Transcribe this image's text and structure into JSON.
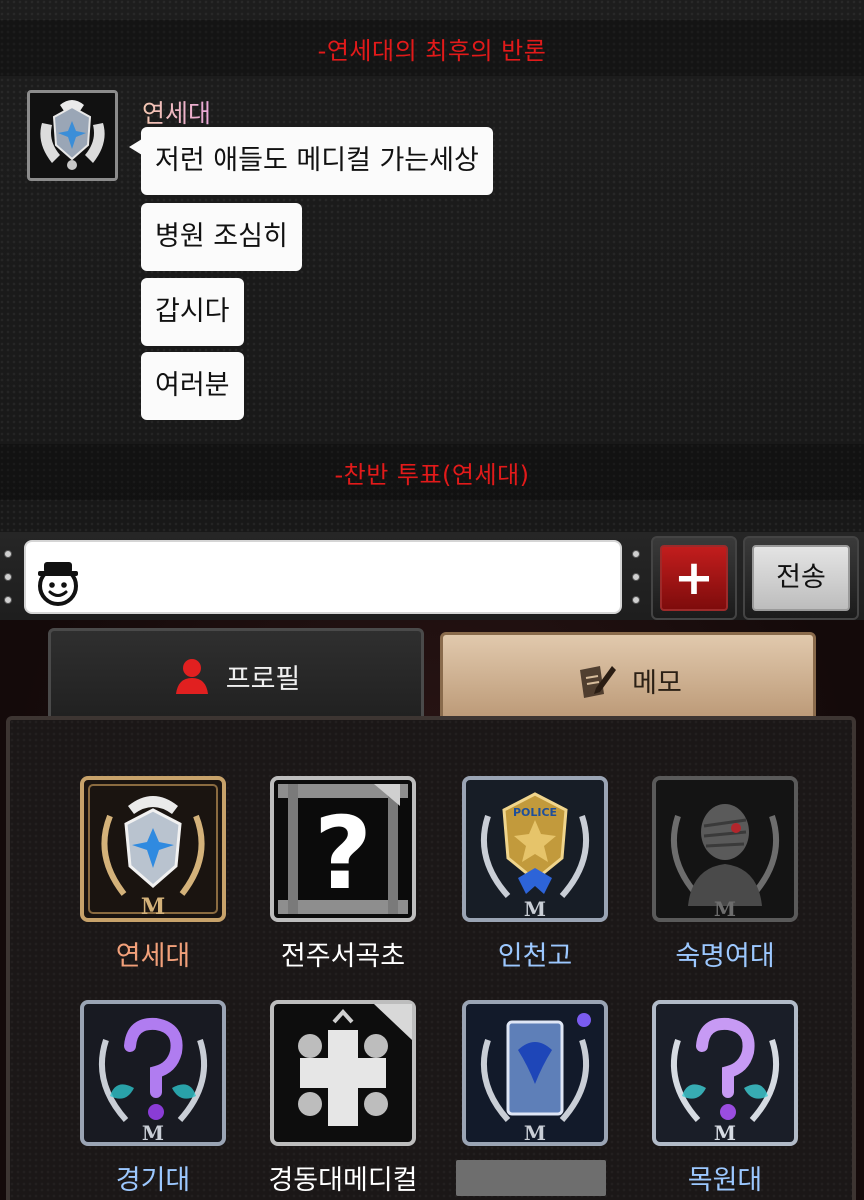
{
  "chat": {
    "system_top": "-연세대의 최후의 반론",
    "system_bottom": "-찬반 투표(연세대)",
    "sender": "연세대",
    "messages": [
      "저런 애들도 메디컬 가는세상",
      "병원 조심히",
      "갑시다",
      "여러분"
    ]
  },
  "input": {
    "value": "",
    "placeholder": "",
    "plus_label": "+",
    "send_label": "전송",
    "emoji_icon": "smiley-hat-icon"
  },
  "tabs": [
    {
      "label": "프로필",
      "icon": "person-icon",
      "active": true
    },
    {
      "label": "메모",
      "icon": "memo-pencil-icon",
      "active": false
    }
  ],
  "players": [
    {
      "name": "연세대",
      "color": "#f2a07a",
      "avatar": "emblem"
    },
    {
      "name": "전주서곡초",
      "color": "#ffffff",
      "avatar": "unknown-jail"
    },
    {
      "name": "인천고",
      "color": "#9cc8ff",
      "avatar": "police-badge"
    },
    {
      "name": "숙명여대",
      "color": "#9cc8ff",
      "avatar": "dead-mummy"
    },
    {
      "name": "경기대",
      "color": "#9cc8ff",
      "avatar": "mystery-ghost"
    },
    {
      "name": "경동대메디컬",
      "color": "#ffffff",
      "avatar": "cross"
    },
    {
      "name": "",
      "color": "#9cc8ff",
      "avatar": "blue-card"
    },
    {
      "name": "목원대",
      "color": "#9cc8ff",
      "avatar": "mystery-ghost"
    }
  ],
  "colors": {
    "system_text": "#e21a1a",
    "bubble": "#fbfbfb",
    "plus_button": "#b01818",
    "memo_tab": "#d6bc9b"
  }
}
